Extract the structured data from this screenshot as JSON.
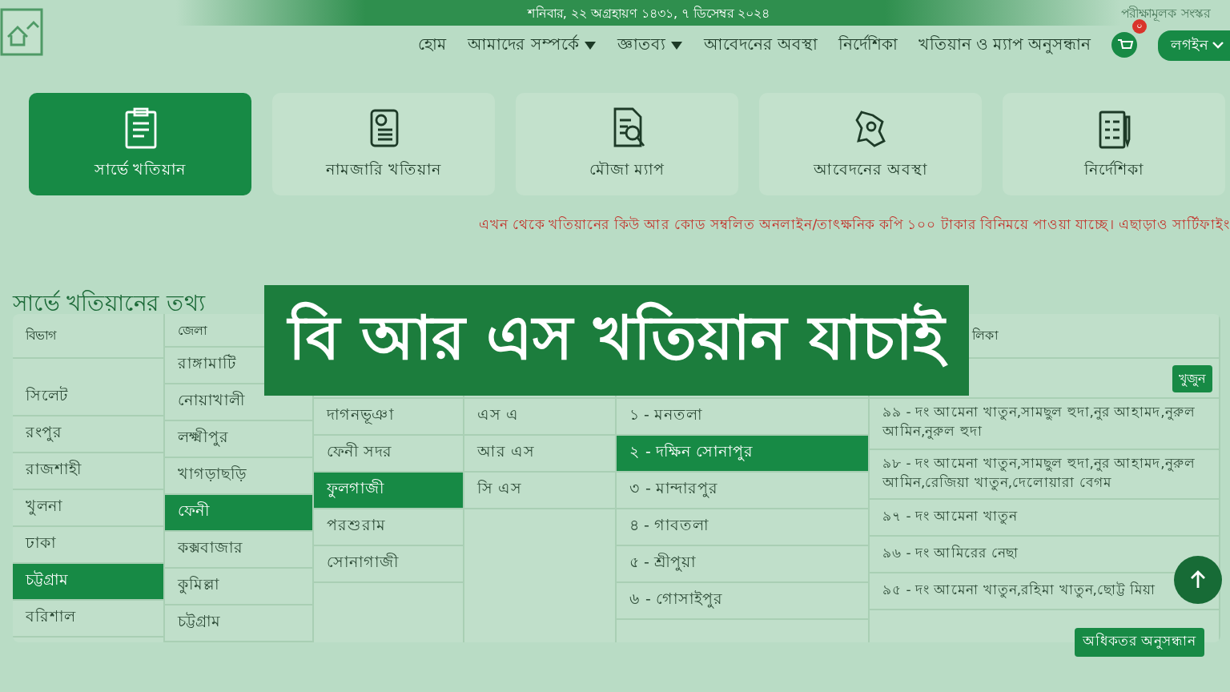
{
  "header": {
    "date": "শনিবার, ২২ অগ্রহায়ণ ১৪৩১, ৭ ডিসেম্বর ২০২৪",
    "edition": "পরীক্ষামূলক সংস্কর"
  },
  "nav": {
    "items": [
      {
        "label": "হোম",
        "dropdown": false
      },
      {
        "label": "আমাদের সম্পর্কে",
        "dropdown": true
      },
      {
        "label": "জ্ঞাতব্য",
        "dropdown": true
      },
      {
        "label": "আবেদনের অবস্থা",
        "dropdown": false
      },
      {
        "label": "নির্দেশিকা",
        "dropdown": false
      },
      {
        "label": "খতিয়ান ও ম্যাপ অনুসন্ধান",
        "dropdown": false
      }
    ],
    "cart_count": "০",
    "login": "লগইন"
  },
  "cards": [
    {
      "label": "সার্ভে খতিয়ান",
      "selected": true,
      "kind": "clipboard"
    },
    {
      "label": "নামজারি খতিয়ান",
      "selected": false,
      "kind": "scroll"
    },
    {
      "label": "মৌজা ম্যাপ",
      "selected": false,
      "kind": "search"
    },
    {
      "label": "আবেদনের অবস্থা",
      "selected": false,
      "kind": "map"
    },
    {
      "label": "নির্দেশিকা",
      "selected": false,
      "kind": "checklist"
    }
  ],
  "notice": "এখন থেকে খতিয়ানের কিউ আর কোড সম্বলিত অনলাইন/তাৎক্ষনিক কপি ১০০ টাকার বিনিময়ে পাওয়া যাচ্ছে। এছাড়াও সার্টিফাইং",
  "section_title": "সার্ভে খতিয়ানের তথ্য",
  "banner": "বি আর এস খতিয়ান যাচাই",
  "columns": [
    {
      "kind": "scrolled",
      "header": "বিভাগ",
      "items": [
        {
          "label": "সিলেট",
          "selected": false
        },
        {
          "label": "রংপুর",
          "selected": false
        },
        {
          "label": "রাজশাহী",
          "selected": false
        },
        {
          "label": "খুলনা",
          "selected": false
        },
        {
          "label": "ঢাকা",
          "selected": false
        },
        {
          "label": "চট্টগ্রাম",
          "selected": true
        },
        {
          "label": "বরিশাল",
          "selected": false
        }
      ]
    },
    {
      "kind": "list",
      "header": "জেলা",
      "items": [
        {
          "label": "রাঙ্গামাটি",
          "selected": false
        },
        {
          "label": "নোয়াখালী",
          "selected": false
        },
        {
          "label": "লক্ষ্মীপুর",
          "selected": false
        },
        {
          "label": "খাগড়াছড়ি",
          "selected": false
        },
        {
          "label": "ফেনী",
          "selected": true
        },
        {
          "label": "কক্সবাজার",
          "selected": false
        },
        {
          "label": "কুমিল্লা",
          "selected": false
        },
        {
          "label": "চট্টগ্রাম",
          "selected": false
        }
      ]
    },
    {
      "kind": "filtered",
      "items": [
        {
          "label": "দাগনভূঞা",
          "selected": false
        },
        {
          "label": "ফেনী সদর",
          "selected": false
        },
        {
          "label": "ফুলগাজী",
          "selected": true
        },
        {
          "label": "পরশুরাম",
          "selected": false
        },
        {
          "label": "সোনাগাজী",
          "selected": false
        }
      ]
    },
    {
      "kind": "filtered",
      "items": [
        {
          "label": "এস এ",
          "selected": false
        },
        {
          "label": "আর এস",
          "selected": false
        },
        {
          "label": "সি এস",
          "selected": false
        }
      ]
    },
    {
      "kind": "filtered",
      "items": [
        {
          "label": "১ - মনতলা",
          "selected": false
        },
        {
          "label": "২ - দক্ষিন সোনাপুর",
          "selected": true
        },
        {
          "label": "৩ - মান্দারপুর",
          "selected": false
        },
        {
          "label": "৪ - গাবতলা",
          "selected": false
        },
        {
          "label": "৫ - শ্রীপুয়া",
          "selected": false
        },
        {
          "label": "৬ - গোসাইপুর",
          "selected": false
        }
      ]
    },
    {
      "kind": "filtered",
      "header": "লিকা",
      "button": "খুজুন",
      "items": [
        {
          "label": "৯৯ - দং আমেনা খাতুন,সামছুল হুদা,নুর আহামদ,নুরুল আমিন,নুরুল হুদা",
          "selected": false
        },
        {
          "label": "৯৮ - দং আমেনা খাতুন,সামছুল হুদা,নুর আহামদ,নুরুল আমিন,রেজিয়া খাতুন,দেলোয়ারা বেগম",
          "selected": false
        },
        {
          "label": "৯৭ - দং আমেনা খাতুন",
          "selected": false
        },
        {
          "label": "৯৬ - দং আমিরের নেছা",
          "selected": false
        },
        {
          "label": "৯৫ - দং আমেনা খাতুন,রহিমা খাতুন,ছোট্ট মিয়া",
          "selected": false
        }
      ]
    }
  ],
  "more_button": "অধিকতর অনুসন্ধান"
}
